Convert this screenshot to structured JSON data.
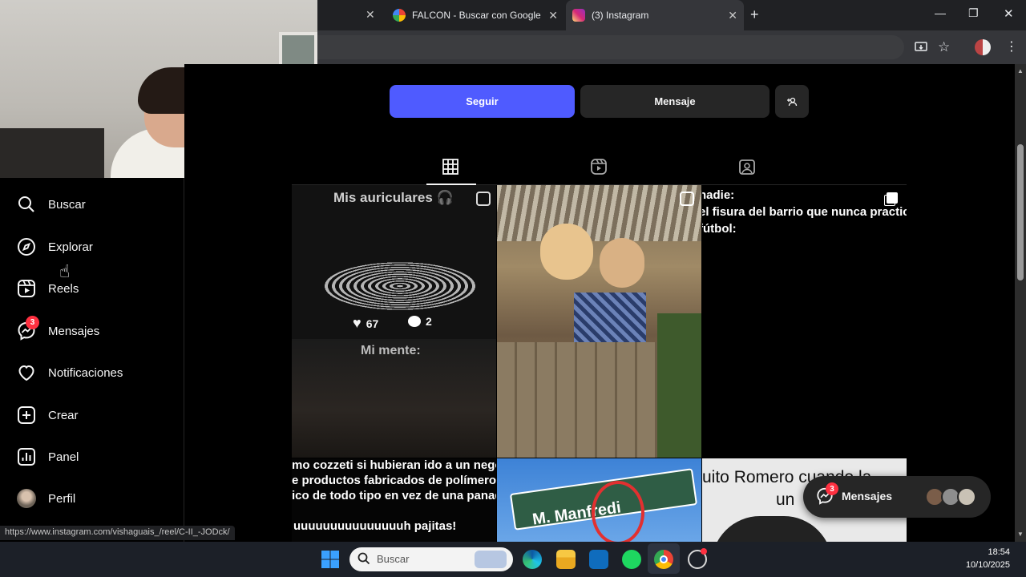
{
  "browser": {
    "tabs": [
      {
        "title": "FALCON - Buscar con Google",
        "active": false
      },
      {
        "title": "(3) Instagram",
        "active": true
      }
    ],
    "new_tab": "+",
    "window_controls": {
      "minimize": "—",
      "restore": "❐",
      "close": "✕"
    },
    "status_url": "https://www.instagram.com/vishaguais_/reel/C-II_-JODck/"
  },
  "profile_actions": {
    "follow": "Seguir",
    "message": "Mensaje",
    "suggest": "+",
    "suggest_icon": "person-plus-icon"
  },
  "sidebar": {
    "items": [
      {
        "label": "Buscar",
        "icon": "search-icon"
      },
      {
        "label": "Explorar",
        "icon": "compass-icon"
      },
      {
        "label": "Reels",
        "icon": "reels-icon"
      },
      {
        "label": "Mensajes",
        "icon": "messenger-icon",
        "badge": "3"
      },
      {
        "label": "Notificaciones",
        "icon": "heart-icon"
      },
      {
        "label": "Crear",
        "icon": "plus-square-icon"
      },
      {
        "label": "Panel",
        "icon": "chart-icon"
      },
      {
        "label": "Perfil",
        "icon": "avatar"
      }
    ]
  },
  "posts": [
    {
      "caption": "Mis auriculares 🎧",
      "likes": "67",
      "comments": "2",
      "caption2": "Mi mente:"
    },
    {
      "caption": ""
    },
    {
      "caption_lines": [
        "nadie:",
        "el fisura del barrio que nunca practic",
        "fútbol:"
      ]
    },
    {
      "caption_lines": [
        "mo cozzeti si hubieran ido a un negocio q",
        "e productos fabricados de polímeros de",
        "ico de todo tipo en vez de una panadería:",
        "uuuuuuuuuuuuuuuh pajitas!"
      ]
    },
    {
      "sign": "M. Manfredi"
    },
    {
      "caption_lines": [
        "uito Romero cuando la",
        "un"
      ]
    }
  ],
  "messages_pill": {
    "label": "Mensajes",
    "badge": "3"
  },
  "taskbar": {
    "search_placeholder": "Buscar",
    "time": "18:54",
    "date": "10/10/2025"
  }
}
